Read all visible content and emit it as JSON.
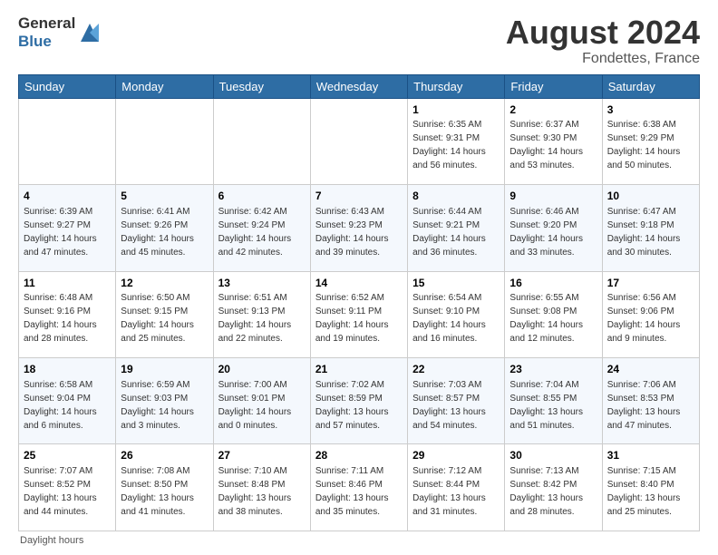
{
  "header": {
    "logo_line1": "General",
    "logo_line2": "Blue",
    "title": "August 2024",
    "location": "Fondettes, France"
  },
  "calendar": {
    "days_of_week": [
      "Sunday",
      "Monday",
      "Tuesday",
      "Wednesday",
      "Thursday",
      "Friday",
      "Saturday"
    ],
    "weeks": [
      [
        {
          "day": "",
          "info": ""
        },
        {
          "day": "",
          "info": ""
        },
        {
          "day": "",
          "info": ""
        },
        {
          "day": "",
          "info": ""
        },
        {
          "day": "1",
          "info": "Sunrise: 6:35 AM\nSunset: 9:31 PM\nDaylight: 14 hours\nand 56 minutes."
        },
        {
          "day": "2",
          "info": "Sunrise: 6:37 AM\nSunset: 9:30 PM\nDaylight: 14 hours\nand 53 minutes."
        },
        {
          "day": "3",
          "info": "Sunrise: 6:38 AM\nSunset: 9:29 PM\nDaylight: 14 hours\nand 50 minutes."
        }
      ],
      [
        {
          "day": "4",
          "info": "Sunrise: 6:39 AM\nSunset: 9:27 PM\nDaylight: 14 hours\nand 47 minutes."
        },
        {
          "day": "5",
          "info": "Sunrise: 6:41 AM\nSunset: 9:26 PM\nDaylight: 14 hours\nand 45 minutes."
        },
        {
          "day": "6",
          "info": "Sunrise: 6:42 AM\nSunset: 9:24 PM\nDaylight: 14 hours\nand 42 minutes."
        },
        {
          "day": "7",
          "info": "Sunrise: 6:43 AM\nSunset: 9:23 PM\nDaylight: 14 hours\nand 39 minutes."
        },
        {
          "day": "8",
          "info": "Sunrise: 6:44 AM\nSunset: 9:21 PM\nDaylight: 14 hours\nand 36 minutes."
        },
        {
          "day": "9",
          "info": "Sunrise: 6:46 AM\nSunset: 9:20 PM\nDaylight: 14 hours\nand 33 minutes."
        },
        {
          "day": "10",
          "info": "Sunrise: 6:47 AM\nSunset: 9:18 PM\nDaylight: 14 hours\nand 30 minutes."
        }
      ],
      [
        {
          "day": "11",
          "info": "Sunrise: 6:48 AM\nSunset: 9:16 PM\nDaylight: 14 hours\nand 28 minutes."
        },
        {
          "day": "12",
          "info": "Sunrise: 6:50 AM\nSunset: 9:15 PM\nDaylight: 14 hours\nand 25 minutes."
        },
        {
          "day": "13",
          "info": "Sunrise: 6:51 AM\nSunset: 9:13 PM\nDaylight: 14 hours\nand 22 minutes."
        },
        {
          "day": "14",
          "info": "Sunrise: 6:52 AM\nSunset: 9:11 PM\nDaylight: 14 hours\nand 19 minutes."
        },
        {
          "day": "15",
          "info": "Sunrise: 6:54 AM\nSunset: 9:10 PM\nDaylight: 14 hours\nand 16 minutes."
        },
        {
          "day": "16",
          "info": "Sunrise: 6:55 AM\nSunset: 9:08 PM\nDaylight: 14 hours\nand 12 minutes."
        },
        {
          "day": "17",
          "info": "Sunrise: 6:56 AM\nSunset: 9:06 PM\nDaylight: 14 hours\nand 9 minutes."
        }
      ],
      [
        {
          "day": "18",
          "info": "Sunrise: 6:58 AM\nSunset: 9:04 PM\nDaylight: 14 hours\nand 6 minutes."
        },
        {
          "day": "19",
          "info": "Sunrise: 6:59 AM\nSunset: 9:03 PM\nDaylight: 14 hours\nand 3 minutes."
        },
        {
          "day": "20",
          "info": "Sunrise: 7:00 AM\nSunset: 9:01 PM\nDaylight: 14 hours\nand 0 minutes."
        },
        {
          "day": "21",
          "info": "Sunrise: 7:02 AM\nSunset: 8:59 PM\nDaylight: 13 hours\nand 57 minutes."
        },
        {
          "day": "22",
          "info": "Sunrise: 7:03 AM\nSunset: 8:57 PM\nDaylight: 13 hours\nand 54 minutes."
        },
        {
          "day": "23",
          "info": "Sunrise: 7:04 AM\nSunset: 8:55 PM\nDaylight: 13 hours\nand 51 minutes."
        },
        {
          "day": "24",
          "info": "Sunrise: 7:06 AM\nSunset: 8:53 PM\nDaylight: 13 hours\nand 47 minutes."
        }
      ],
      [
        {
          "day": "25",
          "info": "Sunrise: 7:07 AM\nSunset: 8:52 PM\nDaylight: 13 hours\nand 44 minutes."
        },
        {
          "day": "26",
          "info": "Sunrise: 7:08 AM\nSunset: 8:50 PM\nDaylight: 13 hours\nand 41 minutes."
        },
        {
          "day": "27",
          "info": "Sunrise: 7:10 AM\nSunset: 8:48 PM\nDaylight: 13 hours\nand 38 minutes."
        },
        {
          "day": "28",
          "info": "Sunrise: 7:11 AM\nSunset: 8:46 PM\nDaylight: 13 hours\nand 35 minutes."
        },
        {
          "day": "29",
          "info": "Sunrise: 7:12 AM\nSunset: 8:44 PM\nDaylight: 13 hours\nand 31 minutes."
        },
        {
          "day": "30",
          "info": "Sunrise: 7:13 AM\nSunset: 8:42 PM\nDaylight: 13 hours\nand 28 minutes."
        },
        {
          "day": "31",
          "info": "Sunrise: 7:15 AM\nSunset: 8:40 PM\nDaylight: 13 hours\nand 25 minutes."
        }
      ]
    ]
  },
  "footer": {
    "note": "Daylight hours"
  }
}
